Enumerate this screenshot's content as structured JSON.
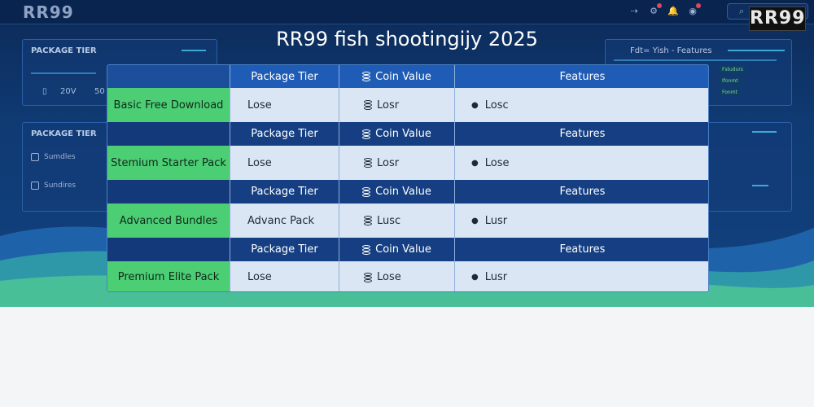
{
  "header": {
    "logo": "RR99",
    "search_icon": "search-icon",
    "brand": "RR99"
  },
  "title": "RR99 fish shootingijy 2025",
  "left_panel_top": {
    "title": "PACKAGE TIER",
    "stat1": "20V",
    "stat2": "50"
  },
  "left_panel_bottom": {
    "title": "PACKAGE TIER",
    "items": [
      {
        "label": "Sumdles"
      },
      {
        "label": "Sundires"
      }
    ]
  },
  "right_panel": {
    "title": "Fdt= Yish - Features",
    "tags": [
      "Fstudurs",
      "Ifonmt",
      "Fonmt"
    ]
  },
  "table": {
    "head_labels": {
      "tier": "Package Tier",
      "coin": "Coin Value",
      "features": "Features"
    },
    "rows": [
      {
        "name": "Basic Free Download",
        "tier": "Lose",
        "coin": "Losr",
        "feature": "Losc"
      },
      {
        "name": "Stemium Starter Pack",
        "tier": "Lose",
        "coin": "Losr",
        "feature": "Lose"
      },
      {
        "name": "Advanced Bundles",
        "tier": "Advanc Pack",
        "coin": "Lusc",
        "feature": "Lusr"
      },
      {
        "name": "Premium Elite Pack",
        "tier": "Lose",
        "coin": "Lose",
        "feature": "Lusr"
      }
    ]
  },
  "colors": {
    "accent_green": "#4cce74",
    "header_blue": "#1f5cb5",
    "cell_bg": "#dbe6f4"
  }
}
